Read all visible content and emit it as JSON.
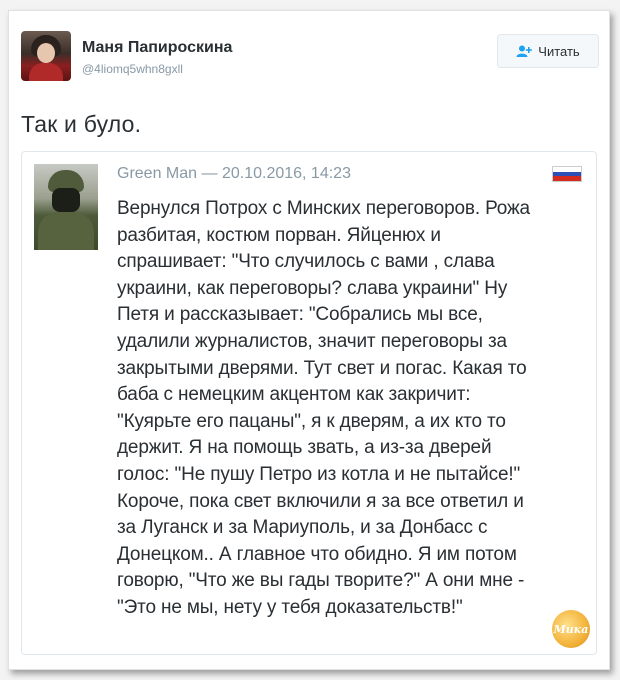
{
  "tweet": {
    "display_name": "Маня Папироскина",
    "handle": "@4liomq5whn8gxll",
    "follow_button_label": "Читать",
    "text": "Так и було."
  },
  "quote": {
    "author": "Green Man",
    "separator": "—",
    "timestamp": "20.10.2016, 14:23",
    "flag": "russia-flag",
    "body": "Вернулся Потрох с Минских переговоров. Рожа\nразбитая, костюм порван. Яйценюх и\nспрашивает: \"Что случилось с вами , слава\nукраини, как переговоры? слава украини\" Ну\nПетя и рассказывает: \"Собрались мы все,\nудалили журналистов, значит переговоры за\nзакрытыми дверями. Тут свет и погас. Какая то\nбаба с немецким акцентом как закричит:\n\"Куярьте его пацаны\", я к дверям, а их кто то\nдержит. Я на помощь звать, а из-за дверей\nголос: \"Не пушу Петро из котла и не пытайсе!\"\nКороче, пока свет включили я за все ответил и\nза Луганск и за Мариуполь, и за Донбасс с\nДонецком.. А главное что обидно. Я им потом\nговорю, \"Что же вы гады творите?\" А они мне -\n\"Это не мы, нету у тебя доказательств!\""
  },
  "watermark_text": "Мика",
  "colors": {
    "text": "#292f33",
    "muted": "#8899a6",
    "border": "#e1e8ed"
  }
}
